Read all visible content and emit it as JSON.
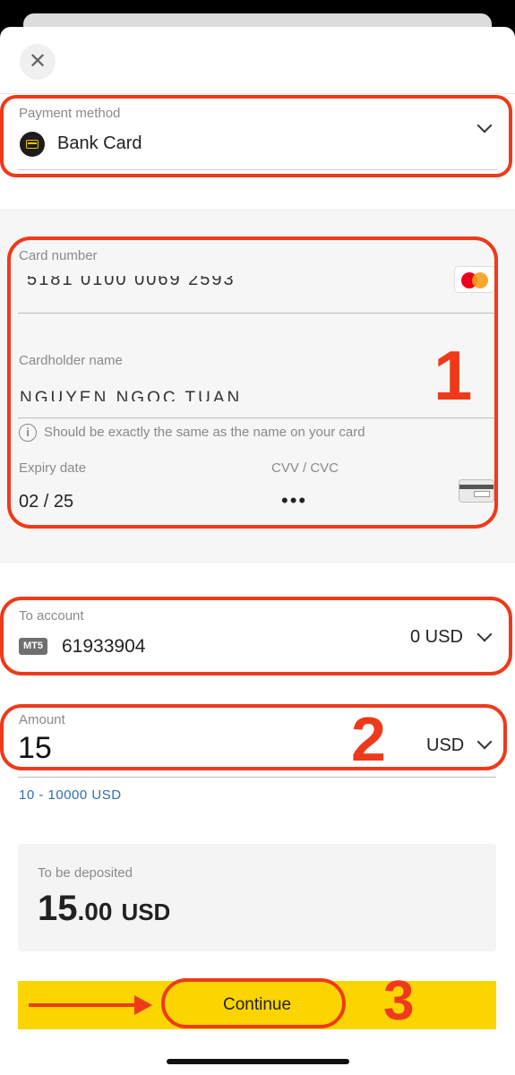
{
  "header": {
    "close_icon": "close-icon"
  },
  "payment_method": {
    "label": "Payment method",
    "value": "Bank Card",
    "icon": "bank-card-icon"
  },
  "card": {
    "number_label": "Card number",
    "number_value": "5181 0100 0069 2593",
    "brand_icon": "mastercard-icon",
    "holder_label": "Cardholder name",
    "holder_value": "NGUYEN NGOC TUAN",
    "hint": "Should be exactly the same as the name on your card",
    "expiry_label": "Expiry date",
    "expiry_value": "02 / 25",
    "cvv_label": "CVV / CVC",
    "cvv_value": "•••"
  },
  "to_account": {
    "label": "To account",
    "badge": "MT5",
    "number": "61933904",
    "balance": "0 USD"
  },
  "amount": {
    "label": "Amount",
    "value": "15",
    "currency": "USD",
    "range": "10 - 10000 USD"
  },
  "deposit": {
    "label": "To be deposited",
    "integer": "15",
    "decimal": ".00",
    "currency": "USD"
  },
  "continue_label": "Continue",
  "annotations": {
    "step1": "1",
    "step2": "2",
    "step3": "3"
  },
  "colors": {
    "accent_yellow": "#fcd400",
    "annotation_red": "#ee3a1a",
    "link_blue": "#2f6cb3"
  }
}
